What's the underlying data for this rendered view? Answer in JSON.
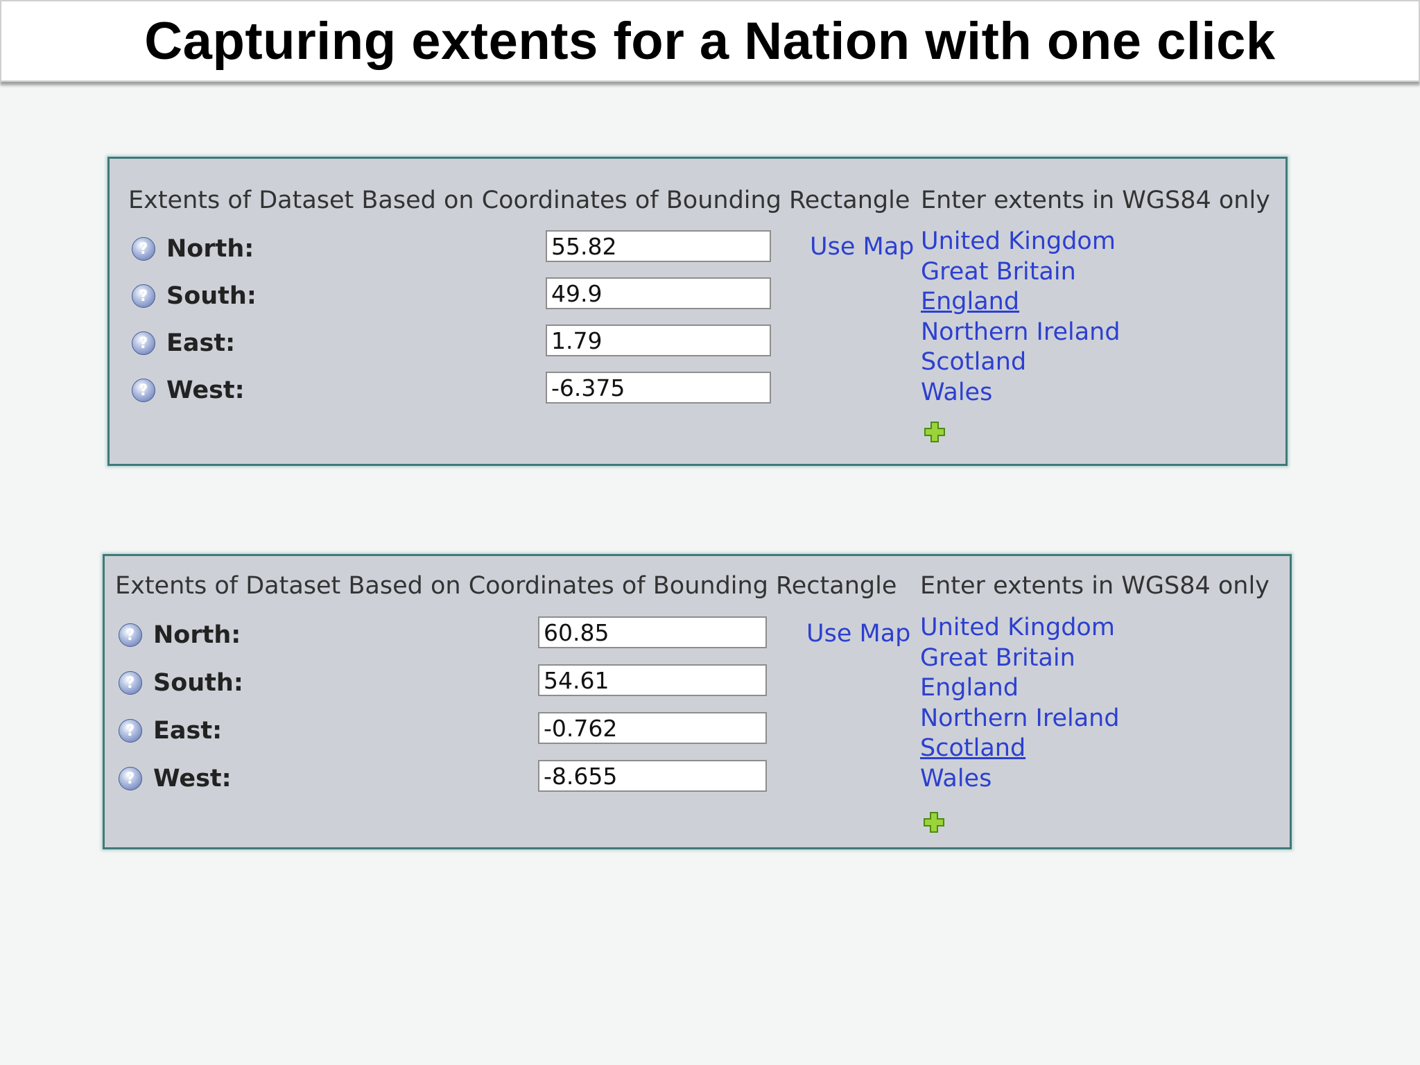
{
  "page_title": "Capturing extents for a Nation with one click",
  "panels": [
    {
      "heading": "Extents of Dataset Based on Coordinates of Bounding Rectangle",
      "wgs_note": "Enter extents in WGS84 only",
      "use_map_label": "Use Map",
      "fields": [
        {
          "label": "North:",
          "value": "55.82"
        },
        {
          "label": "South:",
          "value": "49.9"
        },
        {
          "label": "East:",
          "value": "1.79"
        },
        {
          "label": "West:",
          "value": "-6.375"
        }
      ],
      "nations": [
        "United Kingdom",
        "Great Britain",
        "England",
        "Northern Ireland",
        "Scotland",
        "Wales"
      ],
      "hovered_nation": "England"
    },
    {
      "heading": "Extents of Dataset Based on Coordinates of Bounding Rectangle",
      "wgs_note": "Enter extents in WGS84 only",
      "use_map_label": "Use Map",
      "fields": [
        {
          "label": "North:",
          "value": "60.85"
        },
        {
          "label": "South:",
          "value": "54.61"
        },
        {
          "label": "East:",
          "value": "-0.762"
        },
        {
          "label": "West:",
          "value": "-8.655"
        }
      ],
      "nations": [
        "United Kingdom",
        "Great Britain",
        "England",
        "Northern Ireland",
        "Scotland",
        "Wales"
      ],
      "hovered_nation": "Scotland"
    }
  ],
  "icons": {
    "help": "help-icon",
    "add": "add-icon"
  },
  "colors": {
    "panel_bg": "#cdd1d7",
    "panel_border": "#3f7a78",
    "link": "#2d3fd0"
  }
}
